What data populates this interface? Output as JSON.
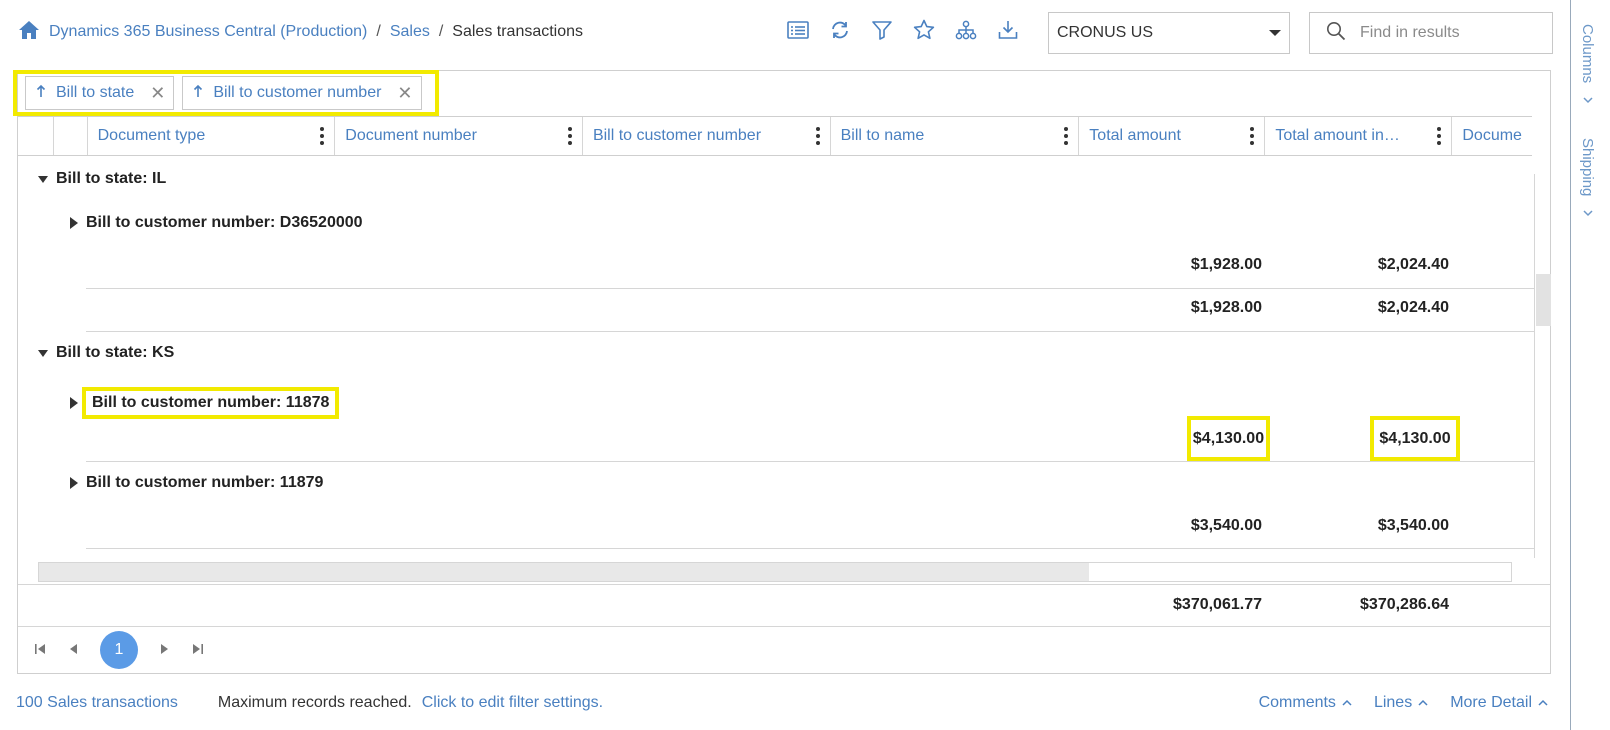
{
  "breadcrumb": {
    "home_icon": "home-icon",
    "environment": "Dynamics 365 Business Central (Production)",
    "section": "Sales",
    "page": "Sales transactions"
  },
  "toolbar": {
    "icons": [
      "list-view-icon",
      "refresh-icon",
      "filter-icon",
      "favorite-star-icon",
      "hierarchy-icon",
      "download-icon"
    ]
  },
  "company": {
    "selected": "CRONUS US"
  },
  "search": {
    "placeholder": "Find in results"
  },
  "side_panel": {
    "columns": "Columns",
    "shipping": "Shipping"
  },
  "group_chips": [
    {
      "label": "Bill to state",
      "sort_icon": "arrow-up-icon"
    },
    {
      "label": "Bill to customer number",
      "sort_icon": "arrow-up-icon"
    }
  ],
  "columns": [
    "Document type",
    "Document number",
    "Bill to customer number",
    "Bill to name",
    "Total amount",
    "Total amount in…",
    "Docume"
  ],
  "groups": [
    {
      "state": "Bill to state: IL",
      "customers": [
        {
          "label": "Bill to customer number: D36520000",
          "total": "$1,928.00",
          "total_incl": "$2,024.40"
        }
      ],
      "subtotal": {
        "total": "$1,928.00",
        "total_incl": "$2,024.40"
      }
    },
    {
      "state": "Bill to state: KS",
      "customers": [
        {
          "label": "Bill to customer number: 11878",
          "total": "$4,130.00",
          "total_incl": "$4,130.00"
        },
        {
          "label": "Bill to customer number: 11879",
          "total": "$3,540.00",
          "total_incl": "$3,540.00"
        }
      ]
    }
  ],
  "grand_total": {
    "total": "$370,061.77",
    "total_incl": "$370,286.64"
  },
  "pager": {
    "current_page": "1"
  },
  "status": {
    "count": "100 Sales transactions",
    "message": "Maximum records reached.",
    "action": "Click to edit filter settings."
  },
  "factboxes": {
    "comments": "Comments",
    "lines": "Lines",
    "more": "More Detail"
  },
  "colors": {
    "accent": "#4a80c0",
    "highlight": "#f2ea00",
    "page_badge": "#5b9be6"
  }
}
